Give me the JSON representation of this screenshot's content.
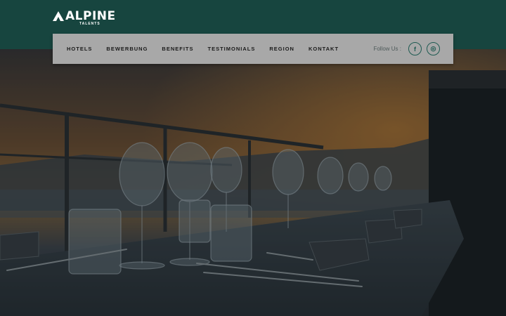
{
  "brand": {
    "logo_text": "ALPINE",
    "logo_subtext": "TALENTS"
  },
  "nav": {
    "items": [
      {
        "label": "HOTELS"
      },
      {
        "label": "BEWERBUNG"
      },
      {
        "label": "BENEFITS"
      },
      {
        "label": "TESTIMONIALS"
      },
      {
        "label": "REGION"
      },
      {
        "label": "KONTAKT"
      }
    ],
    "follow_label": "Follow Us :",
    "social": [
      {
        "icon": "facebook-icon",
        "glyph": "f"
      },
      {
        "icon": "instagram-icon",
        "glyph": "◎"
      }
    ]
  },
  "colors": {
    "topbar": "#17453f",
    "navbar": "#a8a8a8",
    "accent": "#1f5b52"
  }
}
